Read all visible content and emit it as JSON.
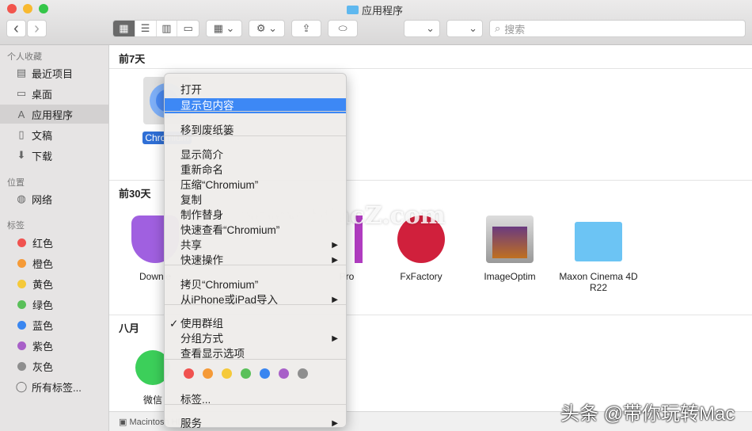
{
  "window": {
    "title": "应用程序"
  },
  "toolbar": {
    "back": "‹",
    "forward": "›",
    "search_placeholder": "搜索"
  },
  "sidebar": {
    "favorites_head": "个人收藏",
    "favorites": [
      "最近项目",
      "桌面",
      "应用程序",
      "文稿",
      "下载"
    ],
    "locations_head": "位置",
    "locations": [
      "网络"
    ],
    "tags_head": "标签",
    "tags": [
      {
        "label": "红色",
        "color": "#f0524f"
      },
      {
        "label": "橙色",
        "color": "#f59a37"
      },
      {
        "label": "黄色",
        "color": "#f5c93a"
      },
      {
        "label": "绿色",
        "color": "#5ac05a"
      },
      {
        "label": "蓝色",
        "color": "#3a86f0"
      },
      {
        "label": "紫色",
        "color": "#a860c8"
      },
      {
        "label": "灰色",
        "color": "#8e8e8e"
      }
    ],
    "all_tags": "所有标签..."
  },
  "content": {
    "sections": [
      "前7天",
      "前30天",
      "八月"
    ],
    "apps": [
      "Chromium",
      "Downie",
      "Pro",
      "FxFactory",
      "ImageOptim",
      "Maxon Cinema 4D R22",
      "微信"
    ]
  },
  "statusbar": {
    "path": "Macintosh HD"
  },
  "menu": {
    "items": [
      "打开",
      "显示包内容",
      "移到废纸篓",
      "显示简介",
      "重新命名",
      "压缩“Chromium”",
      "复制",
      "制作替身",
      "快速查看“Chromium”",
      "共享",
      "快速操作",
      "拷贝“Chromium”",
      "从iPhone或iPad导入",
      "使用群组",
      "分组方式",
      "查看显示选项",
      "标签...",
      "服务"
    ],
    "tag_colors": [
      "#f0524f",
      "#f59a37",
      "#f5c93a",
      "#5ac05a",
      "#3a86f0",
      "#a860c8",
      "#8e8e8e"
    ]
  },
  "watermarks": {
    "center": "www.MacZ.com",
    "corner": "头条 @带你玩转Mac"
  }
}
